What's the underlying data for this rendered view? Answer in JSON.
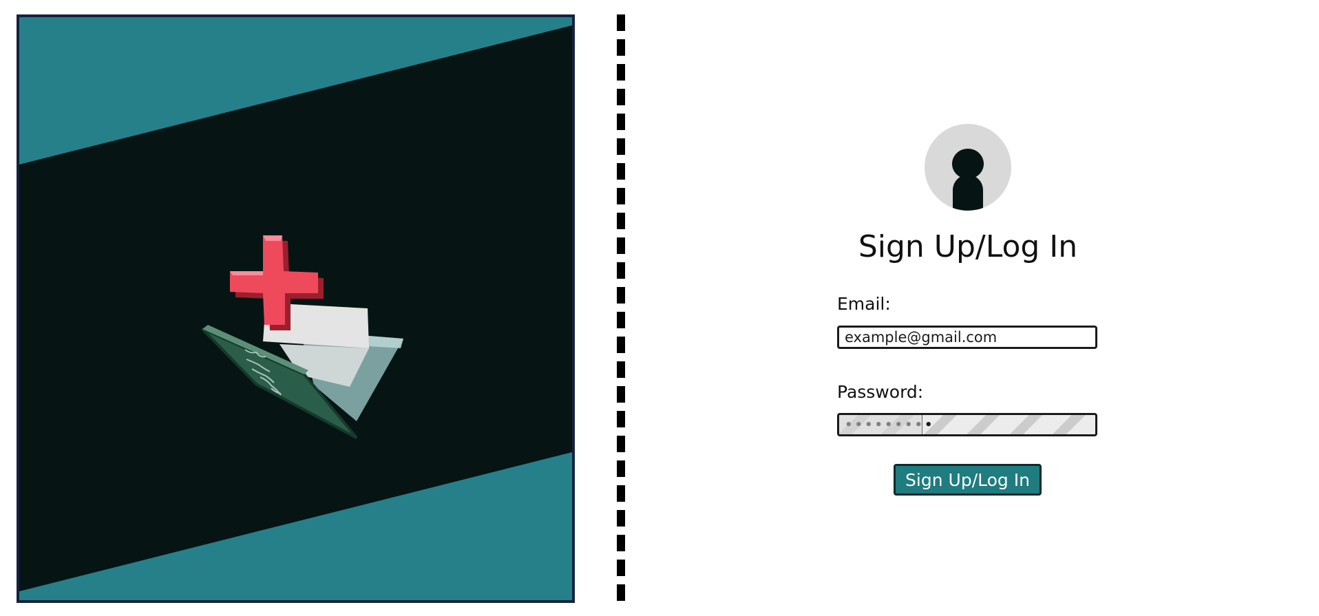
{
  "colors": {
    "hero_background": "#26808a",
    "hero_band": "#061514",
    "hero_border": "#15213f",
    "button_background": "#1f7c7f",
    "avatar_background": "#d9d9d9",
    "avatar_figure": "#061514"
  },
  "hero": {
    "illustration_icon": "medical-folder-icon"
  },
  "auth": {
    "avatar_icon": "user-silhouette-icon",
    "title": "Sign Up/Log In",
    "email_label": "Email:",
    "email_value": "example@gmail.com",
    "password_label": "Password:",
    "password_value": "•••••••••",
    "submit_label": "Sign Up/Log In"
  }
}
